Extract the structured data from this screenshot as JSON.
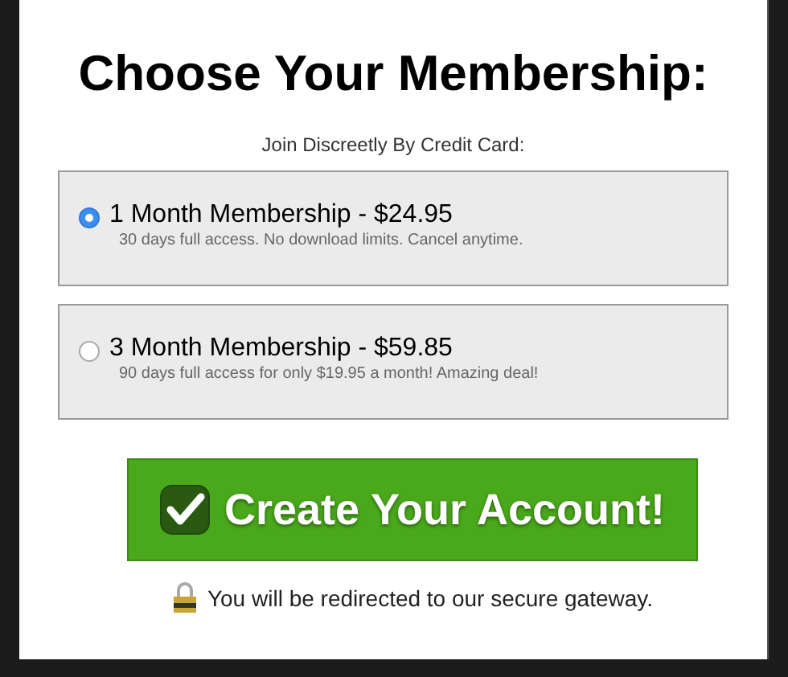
{
  "title": "Choose Your Membership:",
  "subtitle": "Join Discreetly By Credit Card:",
  "plans": [
    {
      "name": "1 Month Membership - $24.95",
      "description": "30 days full access. No download limits. Cancel anytime.",
      "selected": true
    },
    {
      "name": "3 Month Membership - $59.85",
      "description": "90 days full access for only $19.95 a month! Amazing deal!",
      "selected": false
    }
  ],
  "button": {
    "label": "Create Your Account!"
  },
  "notice": "You will be redirected to our secure gateway."
}
